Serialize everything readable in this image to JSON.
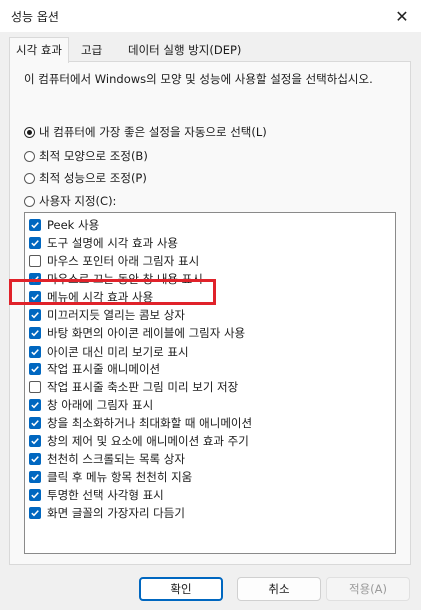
{
  "window": {
    "title": "성능 옵션",
    "close_icon": "close-icon"
  },
  "tabs": [
    {
      "label": "시각 효과",
      "active": true
    },
    {
      "label": "고급",
      "active": false
    },
    {
      "label": "데이터 실행 방지(DEP)",
      "active": false
    }
  ],
  "description": "이 컴퓨터에서 Windows의 모양 및 성능에 사용할 설정을 선택하십시오.",
  "radios": [
    {
      "label": "내 컴퓨터에 가장 좋은 설정을 자동으로 선택(L)",
      "checked": true
    },
    {
      "label": "최적 모양으로 조정(B)",
      "checked": false
    },
    {
      "label": "최적 성능으로 조정(P)",
      "checked": false
    },
    {
      "label": "사용자 지정(C):",
      "checked": false
    }
  ],
  "options": [
    {
      "label": "Peek 사용",
      "checked": true
    },
    {
      "label": "도구 설명에 시각 효과 사용",
      "checked": true
    },
    {
      "label": "마우스 포인터 아래 그림자 표시",
      "checked": false
    },
    {
      "label": "마우스로 끄는 동안 창 내용 표시",
      "checked": true
    },
    {
      "label": "메뉴에 시각 효과 사용",
      "checked": true
    },
    {
      "label": "미끄러지듯 열리는 콤보 상자",
      "checked": true
    },
    {
      "label": "바탕 화면의 아이콘 레이블에 그림자 사용",
      "checked": true
    },
    {
      "label": "아이콘 대신 미리 보기로 표시",
      "checked": true,
      "highlighted": true
    },
    {
      "label": "작업 표시줄 애니메이션",
      "checked": true
    },
    {
      "label": "작업 표시줄 축소판 그림 미리 보기 저장",
      "checked": false
    },
    {
      "label": "창 아래에 그림자 표시",
      "checked": true
    },
    {
      "label": "창을 최소화하거나 최대화할 때 애니메이션",
      "checked": true
    },
    {
      "label": "창의 제어 및 요소에 애니메이션 효과 주기",
      "checked": true
    },
    {
      "label": "천천히 스크롤되는 목록 상자",
      "checked": true
    },
    {
      "label": "클릭 후 메뉴 항목 천천히 지움",
      "checked": true
    },
    {
      "label": "투명한 선택 사각형 표시",
      "checked": true
    },
    {
      "label": "화면 글꼴의 가장자리 다듬기",
      "checked": true
    }
  ],
  "buttons": {
    "ok": "확인",
    "cancel": "취소",
    "apply": "적용(A)"
  },
  "colors": {
    "accent": "#0067c0",
    "highlight": "#e0222a",
    "background": "#f0f0f0"
  }
}
